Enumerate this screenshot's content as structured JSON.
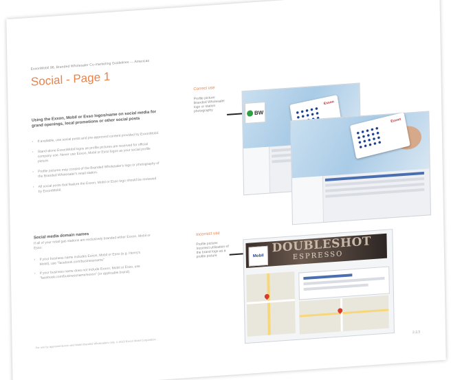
{
  "document": {
    "breadcrumb": "ExxonMobil 96, Branded Wholesaler Co-marketing Guidelines — Americas",
    "title": "Social - Page 1",
    "intro": "Using the Exxon, Mobil or Esso logos/name on social media for grand openings, local promotions or other social posts",
    "bullets": [
      "If available, use social posts and pre-approved content provided by ExxonMobil.",
      "Stand-alone ExxonMobil logos as profile pictures are reserved for official company use. Never use Exxon, Mobil or Esso logos as your social profile picture.",
      "Profile pictures may consist of the Branded Wholesaler's logo or photography of the Branded Wholesaler's retail station.",
      "All social posts that feature the Exxon, Mobil or Esso logo should be reviewed by ExxonMobil."
    ],
    "social_media_heading": "Social media domain names",
    "social_media_intro": "If all of your retail gas stations are exclusively branded either Exxon, Mobil or Esso:",
    "social_media_bullets": [
      "If your business name includes Exxon, Mobil or Esso (e.g. Henry's Mobil), use \"facebook.com/businessname\"",
      "If your business name does not include Exxon, Mobil or Esso, use \"facebook.com/businessname/exxon\" (or applicable brand)."
    ],
    "footer": "For use by approved Exxon and Mobil Branded Wholesalers only. © 2019 Exxon Mobil Corporation",
    "page_number": "2.3.3"
  },
  "examples": {
    "correct_label": "Correct use",
    "correct_note": "Profile picture: Branded Wholesaler logo or station photography",
    "bw_logo_text": "BW",
    "card_brand": "Exxon",
    "incorrect_label": "Incorrect use",
    "incorrect_note": "Profile picture: Incorrect utilization of the brand logo as a profile picture",
    "banner_text": "DOUBLESHOT",
    "banner_sub": "ESPRESSO",
    "mobil_avatar_text": "Mobil",
    "strike_color": "#e03a2c"
  }
}
